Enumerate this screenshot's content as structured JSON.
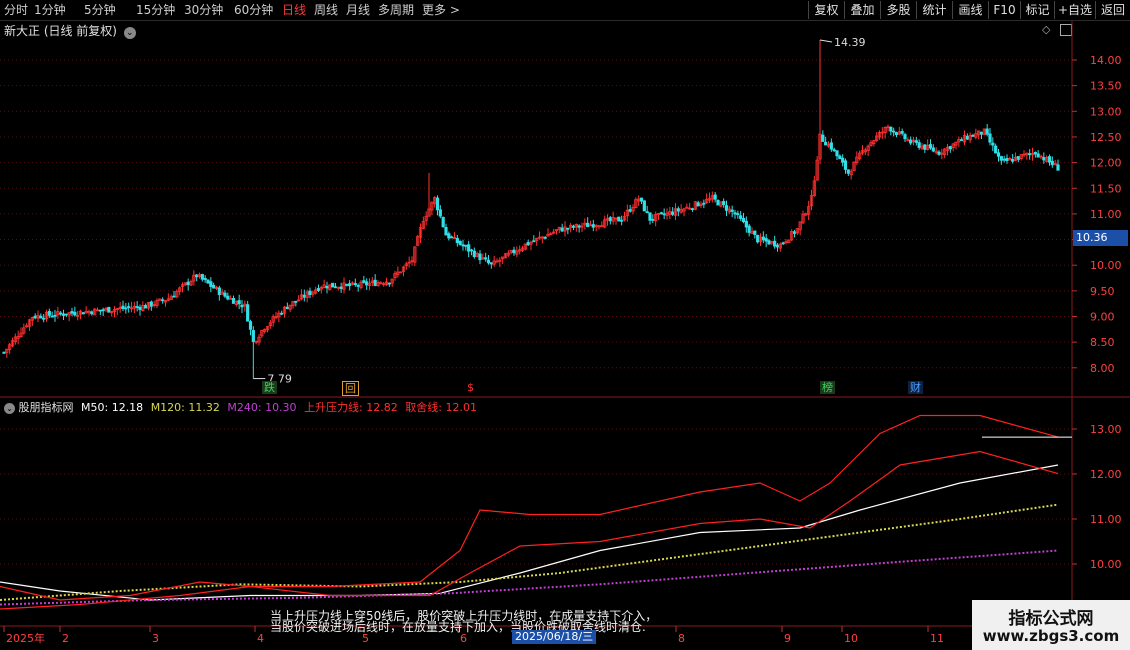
{
  "toolbar": {
    "periods": [
      "分时",
      "1分钟",
      "5分钟",
      "15分钟",
      "30分钟",
      "60分钟",
      "日线",
      "周线",
      "月线",
      "多周期",
      "更多 >"
    ],
    "active_period": "日线",
    "buttons": [
      "复权",
      "叠加",
      "多股",
      "统计",
      "画线",
      "F10",
      "标记",
      "+自选",
      "返回"
    ]
  },
  "stock_title": "新大正 (日线 前复权)",
  "price_axis": [
    "14.00",
    "13.50",
    "13.00",
    "12.50",
    "12.00",
    "11.50",
    "11.00",
    "10.50",
    "10.00",
    "9.50",
    "9.00",
    "8.50",
    "8.00"
  ],
  "current_price": "10.36",
  "high_label": "14.39",
  "low_label": "7.79",
  "event_tags": [
    {
      "text": "跌",
      "color": "#3bd45c"
    },
    {
      "text": "回",
      "color": "#e0a030"
    },
    {
      "text": "$",
      "color": "#ff3030"
    },
    {
      "text": "榜",
      "color": "#3bd45c"
    },
    {
      "text": "财",
      "color": "#4aa0ff"
    }
  ],
  "indicator": {
    "name": "股朋指标网",
    "m50": "M50: 12.18",
    "m120": "M120: 11.32",
    "m240": "M240: 10.30",
    "pressure": "上升压力线: 12.82",
    "stop": "取舍线: 12.01",
    "axis": [
      "13.00",
      "12.00",
      "11.00",
      "10.00"
    ]
  },
  "notes": [
    "当上升压力线上穿50线后，股价突破上升压力线时，在成量支持下介入，",
    "当股价突破进场后线时，在放量支持下加入，当股价跌破取舍线时清仓."
  ],
  "x_axis": [
    "2025年",
    "2",
    "3",
    "4",
    "5",
    "6",
    "7",
    "8",
    "9",
    "10",
    "11"
  ],
  "crosshair_date": "2025/06/18/三",
  "watermark": {
    "title": "指标公式网",
    "url": "www.zbgs3.com"
  },
  "colors": {
    "up": "#ff3030",
    "down": "#30e0e8",
    "m50": "#ffffff",
    "m120": "#d8d850",
    "m240": "#c040d0",
    "pressure": "#ff2020",
    "grid": "#5a1010"
  }
}
